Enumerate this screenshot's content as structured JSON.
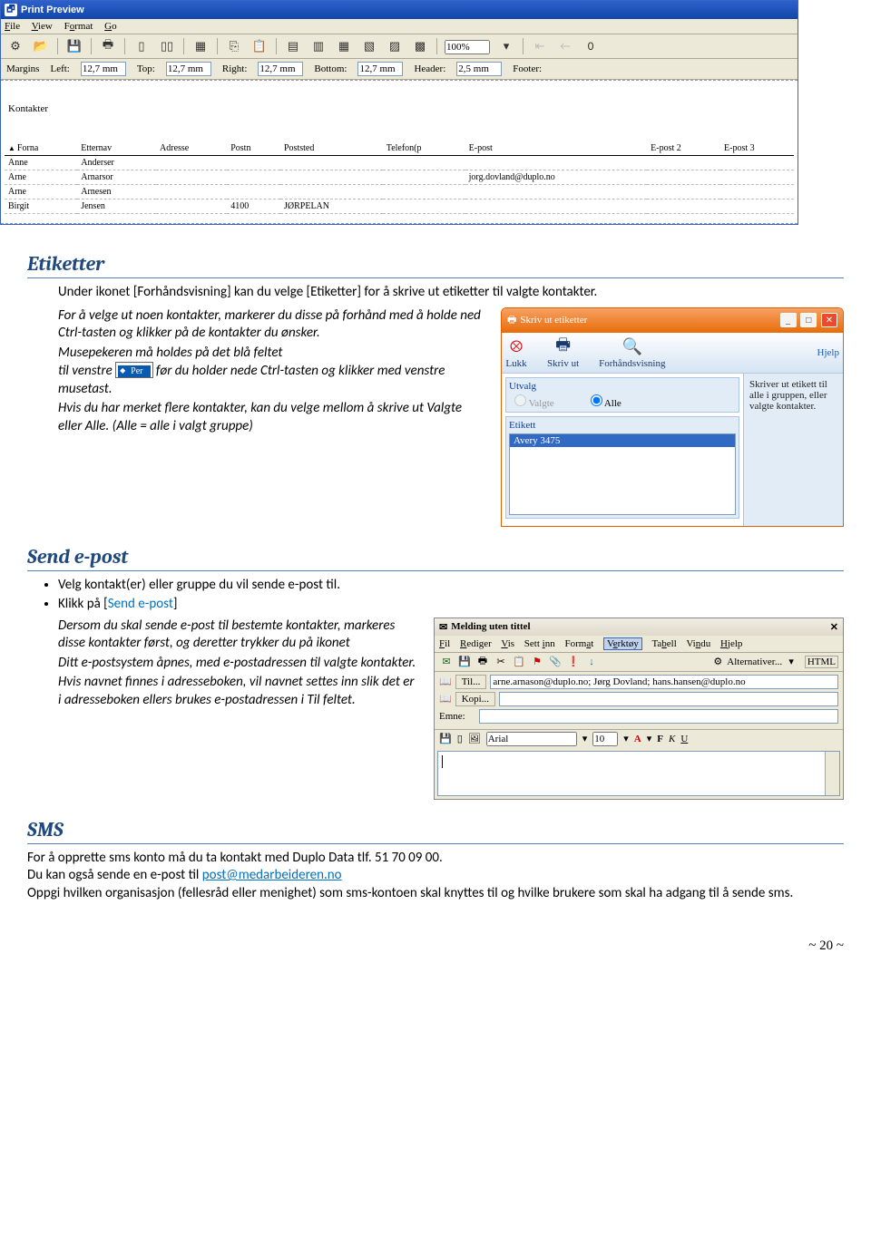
{
  "printPreview": {
    "title": "Print Preview",
    "menu": [
      "File",
      "View",
      "Format",
      "Go"
    ],
    "zoom": "100%",
    "margins": {
      "label": "Margins",
      "left": "Left:",
      "leftVal": "12,7 mm",
      "top": "Top:",
      "topVal": "12,7 mm",
      "right": "Right:",
      "rightVal": "12,7 mm",
      "bottom": "Bottom:",
      "bottomVal": "12,7 mm",
      "header": "Header:",
      "headerVal": "2,5 mm",
      "footer": "Footer:"
    },
    "docTitle": "Kontakter",
    "headers": [
      "Forna",
      "Etternav",
      "Adresse",
      "Postn",
      "Poststed",
      "Telefon(p",
      "E-post",
      "E-post 2",
      "E-post 3"
    ],
    "rows": [
      {
        "f": "Anne",
        "e": "Anderser",
        "a": "",
        "pn": "",
        "ps": "",
        "t": "",
        "ep": "",
        "ep2": "",
        "ep3": ""
      },
      {
        "f": "Arne",
        "e": "Arnarsor",
        "a": "",
        "pn": "",
        "ps": "",
        "t": "",
        "ep": "jorg.dovland@duplo.no",
        "ep2": "",
        "ep3": ""
      },
      {
        "f": "Arne",
        "e": "Arnesen",
        "a": "",
        "pn": "",
        "ps": "",
        "t": "",
        "ep": "",
        "ep2": "",
        "ep3": ""
      },
      {
        "f": "Birgit",
        "e": "Jensen",
        "a": "",
        "pn": "4100",
        "ps": "JØRPELAN",
        "t": "",
        "ep": "",
        "ep2": "",
        "ep3": ""
      }
    ]
  },
  "etik": {
    "heading": "Etiketter",
    "intro": "Under ikonet [Forhåndsvisning] kan du velge [Etiketter] for å skrive ut etiketter til valgte kontakter.",
    "p1": "For å velge ut noen kontakter, markerer du disse på forhånd med å holde ned Ctrl-tasten og klikker på de kontakter du ønsker.",
    "p2a": "Musepekeren må holdes på det blå feltet",
    "p2b": "til venstre",
    "per": "Per",
    "p2c": "før du holder nede Ctrl-tasten og klikker med venstre musetast.",
    "p3": "Hvis du har merket flere kontakter, kan du velge mellom å skrive ut Valgte eller Alle. (Alle = alle i valgt gruppe)"
  },
  "etikDlg": {
    "title": "Skriv ut etiketter",
    "lukk": "Lukk",
    "skriv": "Skriv ut",
    "forh": "Forhåndsvisning",
    "hjelp": "Hjelp",
    "utvalg": "Utvalg",
    "valgte": "Valgte",
    "alle": "Alle",
    "etikett": "Etikett",
    "sel": "Avery 3475",
    "desc": "Skriver ut etikett til alle i gruppen, eller valgte kontakter."
  },
  "send": {
    "heading": "Send e-post",
    "b1": "Velg kontakt(er) eller gruppe du vil sende e-post til.",
    "b2a": "Klikk på [",
    "b2link": "Send e-post",
    "b2b": "]",
    "p1": "Dersom du skal sende e-post til bestemte kontakter, markeres disse kontakter først, og deretter trykker du på ikonet",
    "p2": "Ditt e-postsystem åpnes, med e-postadressen til valgte kontakter.",
    "p3": "Hvis navnet finnes i adresseboken, vil navnet settes inn slik det er i adresseboken ellers brukes e-postadressen i Til feltet."
  },
  "mail": {
    "title": "Melding uten tittel",
    "menu": [
      "Fil",
      "Rediger",
      "Vis",
      "Sett inn",
      "Format",
      "Verktøy",
      "Tabell",
      "Vindu",
      "Hjelp"
    ],
    "boxed": "Verktøy",
    "alt": "Alternativer...",
    "html": "HTML",
    "til": "Til...",
    "kopi": "Kopi...",
    "emne": "Emne:",
    "tilVal": "arne.arnason@duplo.no; Jørg Dovland; hans.hansen@duplo.no",
    "font": "Arial",
    "size": "10"
  },
  "sms": {
    "heading": "SMS",
    "p1": "For å opprette sms konto må du ta kontakt med Duplo Data tlf. 51 70 09 00.",
    "p2a": "Du kan også sende en e-post til ",
    "link": "post@medarbeideren.no",
    "p3": "Oppgi hvilken organisasjon (fellesråd eller menighet) som sms-kontoen skal knyttes til og hvilke brukere som skal ha adgang til å sende sms."
  },
  "pageno": "~ 20 ~"
}
